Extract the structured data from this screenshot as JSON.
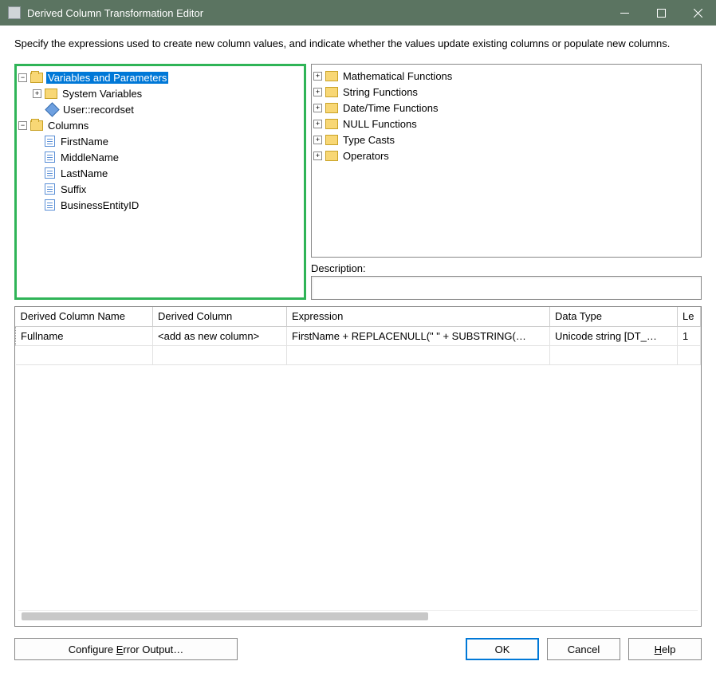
{
  "window": {
    "title": "Derived Column Transformation Editor"
  },
  "description": "Specify the expressions used to create new column values, and indicate whether the values update existing columns or populate new columns.",
  "leftTree": {
    "varsParams": {
      "label": "Variables and Parameters",
      "expanded": "−"
    },
    "systemVars": {
      "label": "System Variables",
      "expanded": "+"
    },
    "userRecordset": {
      "label": "User::recordset"
    },
    "columns": {
      "label": "Columns",
      "expanded": "−"
    },
    "col1": {
      "label": "FirstName"
    },
    "col2": {
      "label": "MiddleName"
    },
    "col3": {
      "label": "LastName"
    },
    "col4": {
      "label": "Suffix"
    },
    "col5": {
      "label": "BusinessEntityID"
    }
  },
  "rightTree": {
    "f1": {
      "label": "Mathematical Functions",
      "expanded": "+"
    },
    "f2": {
      "label": "String Functions",
      "expanded": "+"
    },
    "f3": {
      "label": "Date/Time Functions",
      "expanded": "+"
    },
    "f4": {
      "label": "NULL Functions",
      "expanded": "+"
    },
    "f5": {
      "label": "Type Casts",
      "expanded": "+"
    },
    "f6": {
      "label": "Operators",
      "expanded": "+"
    }
  },
  "descBox": {
    "label": "Description:"
  },
  "grid": {
    "headers": {
      "name": "Derived Column Name",
      "derived": "Derived Column",
      "expr": "Expression",
      "dtype": "Data Type",
      "len": "Le"
    },
    "row1": {
      "name": "Fullname",
      "derived": "<add as new column>",
      "expr": "FirstName + REPLACENULL(\" \" + SUBSTRING(…",
      "dtype": "Unicode string [DT_…",
      "len": "1"
    }
  },
  "buttons": {
    "configErr": "Configure Error Output…",
    "ok": "OK",
    "cancel": "Cancel",
    "help": "Help"
  }
}
